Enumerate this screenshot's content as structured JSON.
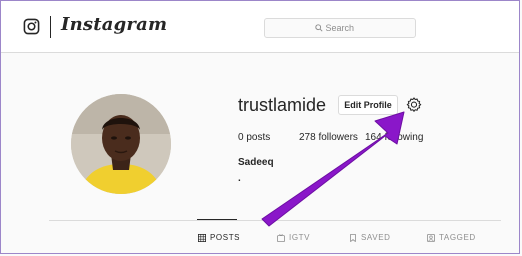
{
  "nav": {
    "brand": "Instagram",
    "logo_icon": "instagram-camera-icon",
    "search_placeholder": "Search",
    "search_icon": "search-icon"
  },
  "profile": {
    "username": "trustlamide",
    "edit_button_label": "Edit Profile",
    "settings_icon": "gear-icon",
    "stats": {
      "posts": "0 posts",
      "followers": "278 followers",
      "following": "164 following"
    },
    "full_name": "Sadeeq",
    "bio": "."
  },
  "tabs": [
    {
      "label": "POSTS",
      "icon": "grid-icon",
      "active": true
    },
    {
      "label": "IGTV",
      "icon": "tv-icon",
      "active": false
    },
    {
      "label": "SAVED",
      "icon": "bookmark-icon",
      "active": false
    },
    {
      "label": "TAGGED",
      "icon": "tag-person-icon",
      "active": false
    }
  ],
  "annotation": {
    "arrow_color": "#8a17c9",
    "points_to": "gear-icon"
  },
  "colors": {
    "border": "#dbdbdb",
    "text": "#262626",
    "muted": "#8e8e8e",
    "background": "#fafafa"
  }
}
